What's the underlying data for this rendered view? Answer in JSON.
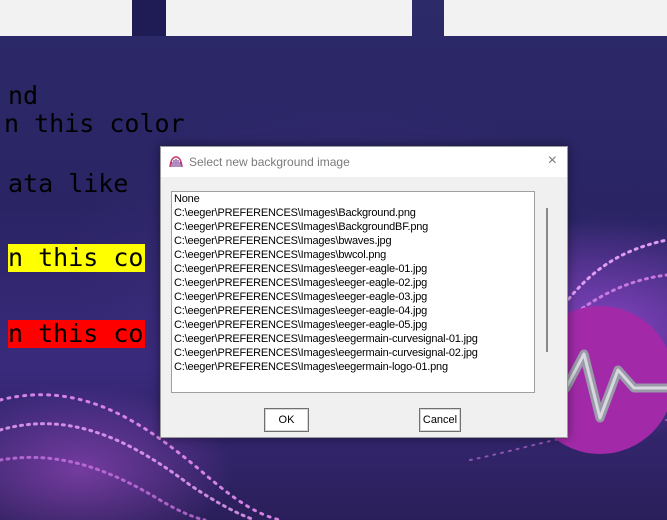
{
  "background": {
    "text_lines": [
      "nd",
      "n this color",
      "ata like",
      "n this co",
      "n this co"
    ]
  },
  "dialog": {
    "title": "Select new background image",
    "close_symbol": "×",
    "items": [
      "None",
      "C:\\eeger\\PREFERENCES\\Images\\Background.png",
      "C:\\eeger\\PREFERENCES\\Images\\BackgroundBF.png",
      "C:\\eeger\\PREFERENCES\\Images\\bwaves.jpg",
      "C:\\eeger\\PREFERENCES\\Images\\bwcol.png",
      "C:\\eeger\\PREFERENCES\\Images\\eeger-eagle-01.jpg",
      "C:\\eeger\\PREFERENCES\\Images\\eeger-eagle-02.jpg",
      "C:\\eeger\\PREFERENCES\\Images\\eeger-eagle-03.jpg",
      "C:\\eeger\\PREFERENCES\\Images\\eeger-eagle-04.jpg",
      "C:\\eeger\\PREFERENCES\\Images\\eeger-eagle-05.jpg",
      "C:\\eeger\\PREFERENCES\\Images\\eegermain-curvesignal-01.jpg",
      "C:\\eeger\\PREFERENCES\\Images\\eegermain-curvesignal-02.jpg",
      "C:\\eeger\\PREFERENCES\\Images\\eegermain-logo-01.png"
    ],
    "ok_label": "OK",
    "cancel_label": "Cancel"
  },
  "colors": {
    "highlight_yellow": "#ffff00",
    "highlight_red": "#ff0000",
    "logo_purple": "#a22aa8"
  },
  "icons": [
    "app-icon",
    "close-icon",
    "logo-icon"
  ]
}
